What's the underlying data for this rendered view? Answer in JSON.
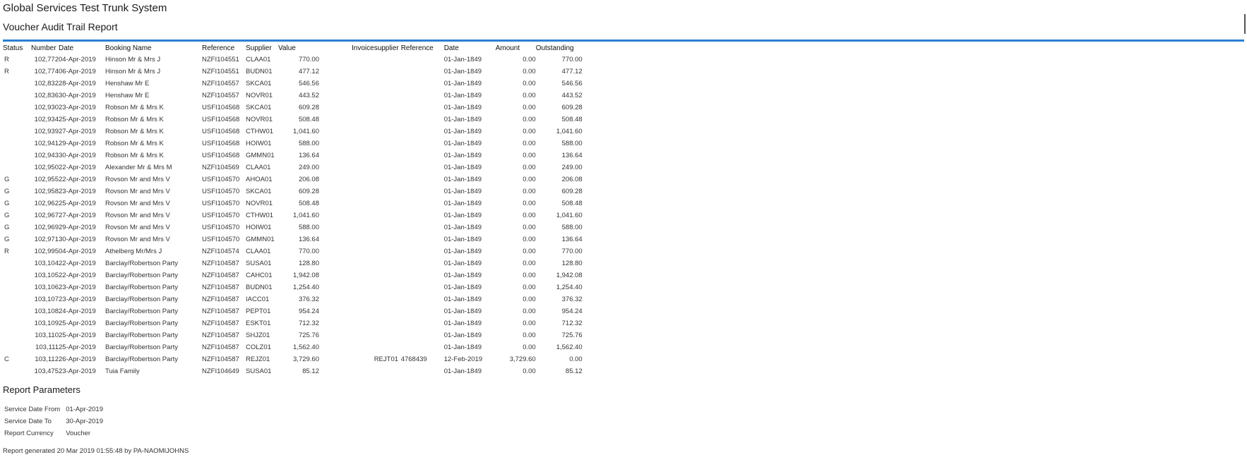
{
  "header": {
    "app_title": "Global Services Test Trunk System",
    "report_title": "Voucher Audit Trail Report",
    "accent_color": "#2a7fd4"
  },
  "table": {
    "columns": [
      "Status",
      "Number",
      "Date",
      "Booking Name",
      "Reference",
      "Supplier",
      "Value",
      "Invoice",
      "supplier",
      "Reference",
      "Date",
      "Amount",
      "Outstanding"
    ],
    "rows": [
      [
        "R",
        "102,772",
        "04-Apr-2019",
        "Hinson Mr & Mrs J",
        "NZFI104551",
        "CLAA01",
        "770.00",
        "",
        "",
        "",
        "01-Jan-1849",
        "0.00",
        "770.00"
      ],
      [
        "R",
        "102,774",
        "06-Apr-2019",
        "Hinson Mr & Mrs J",
        "NZFI104551",
        "BUDN01",
        "477.12",
        "",
        "",
        "",
        "01-Jan-1849",
        "0.00",
        "477.12"
      ],
      [
        "",
        "102,832",
        "28-Apr-2019",
        "Henshaw Mr E",
        "NZFI104557",
        "SKCA01",
        "546.56",
        "",
        "",
        "",
        "01-Jan-1849",
        "0.00",
        "546.56"
      ],
      [
        "",
        "102,836",
        "30-Apr-2019",
        "Henshaw Mr E",
        "NZFI104557",
        "NOVR01",
        "443.52",
        "",
        "",
        "",
        "01-Jan-1849",
        "0.00",
        "443.52"
      ],
      [
        "",
        "102,930",
        "23-Apr-2019",
        "Robson Mr & Mrs K",
        "USFI104568",
        "SKCA01",
        "609.28",
        "",
        "",
        "",
        "01-Jan-1849",
        "0.00",
        "609.28"
      ],
      [
        "",
        "102,934",
        "25-Apr-2019",
        "Robson Mr & Mrs K",
        "USFI104568",
        "NOVR01",
        "508.48",
        "",
        "",
        "",
        "01-Jan-1849",
        "0.00",
        "508.48"
      ],
      [
        "",
        "102,939",
        "27-Apr-2019",
        "Robson Mr & Mrs K",
        "USFI104568",
        "CTHW01",
        "1,041.60",
        "",
        "",
        "",
        "01-Jan-1849",
        "0.00",
        "1,041.60"
      ],
      [
        "",
        "102,941",
        "29-Apr-2019",
        "Robson Mr & Mrs K",
        "USFI104568",
        "HOIW01",
        "588.00",
        "",
        "",
        "",
        "01-Jan-1849",
        "0.00",
        "588.00"
      ],
      [
        "",
        "102,943",
        "30-Apr-2019",
        "Robson Mr & Mrs K",
        "USFI104568",
        "GMMN01",
        "136.64",
        "",
        "",
        "",
        "01-Jan-1849",
        "0.00",
        "136.64"
      ],
      [
        "",
        "102,950",
        "22-Apr-2019",
        "Alexander Mr & Mrs M",
        "NZFI104569",
        "CLAA01",
        "249.00",
        "",
        "",
        "",
        "01-Jan-1849",
        "0.00",
        "249.00"
      ],
      [
        "G",
        "102,955",
        "22-Apr-2019",
        "Rovson Mr and Mrs V",
        "USFI104570",
        "AHOA01",
        "206.08",
        "",
        "",
        "",
        "01-Jan-1849",
        "0.00",
        "206.08"
      ],
      [
        "G",
        "102,958",
        "23-Apr-2019",
        "Rovson Mr and Mrs V",
        "USFI104570",
        "SKCA01",
        "609.28",
        "",
        "",
        "",
        "01-Jan-1849",
        "0.00",
        "609.28"
      ],
      [
        "G",
        "102,962",
        "25-Apr-2019",
        "Rovson Mr and Mrs V",
        "USFI104570",
        "NOVR01",
        "508.48",
        "",
        "",
        "",
        "01-Jan-1849",
        "0.00",
        "508.48"
      ],
      [
        "G",
        "102,967",
        "27-Apr-2019",
        "Rovson Mr and Mrs V",
        "USFI104570",
        "CTHW01",
        "1,041.60",
        "",
        "",
        "",
        "01-Jan-1849",
        "0.00",
        "1,041.60"
      ],
      [
        "G",
        "102,969",
        "29-Apr-2019",
        "Rovson Mr and Mrs V",
        "USFI104570",
        "HOIW01",
        "588.00",
        "",
        "",
        "",
        "01-Jan-1849",
        "0.00",
        "588.00"
      ],
      [
        "G",
        "102,971",
        "30-Apr-2019",
        "Rovson Mr and Mrs V",
        "USFI104570",
        "GMMN01",
        "136.64",
        "",
        "",
        "",
        "01-Jan-1849",
        "0.00",
        "136.64"
      ],
      [
        "R",
        "102,995",
        "04-Apr-2019",
        "Athelberg Mr/Mrs J",
        "NZFI104574",
        "CLAA01",
        "770.00",
        "",
        "",
        "",
        "01-Jan-1849",
        "0.00",
        "770.00"
      ],
      [
        "",
        "103,104",
        "22-Apr-2019",
        "Barclay/Robertson Party",
        "NZFI104587",
        "SUSA01",
        "128.80",
        "",
        "",
        "",
        "01-Jan-1849",
        "0.00",
        "128.80"
      ],
      [
        "",
        "103,105",
        "22-Apr-2019",
        "Barclay/Robertson Party",
        "NZFI104587",
        "CAHC01",
        "1,942.08",
        "",
        "",
        "",
        "01-Jan-1849",
        "0.00",
        "1,942.08"
      ],
      [
        "",
        "103,106",
        "23-Apr-2019",
        "Barclay/Robertson Party",
        "NZFI104587",
        "BUDN01",
        "1,254.40",
        "",
        "",
        "",
        "01-Jan-1849",
        "0.00",
        "1,254.40"
      ],
      [
        "",
        "103,107",
        "23-Apr-2019",
        "Barclay/Robertson Party",
        "NZFI104587",
        "IACC01",
        "376.32",
        "",
        "",
        "",
        "01-Jan-1849",
        "0.00",
        "376.32"
      ],
      [
        "",
        "103,108",
        "24-Apr-2019",
        "Barclay/Robertson Party",
        "NZFI104587",
        "PEPT01",
        "954.24",
        "",
        "",
        "",
        "01-Jan-1849",
        "0.00",
        "954.24"
      ],
      [
        "",
        "103,109",
        "25-Apr-2019",
        "Barclay/Robertson Party",
        "NZFI104587",
        "ESKT01",
        "712.32",
        "",
        "",
        "",
        "01-Jan-1849",
        "0.00",
        "712.32"
      ],
      [
        "",
        "103,110",
        "25-Apr-2019",
        "Barclay/Robertson Party",
        "NZFI104587",
        "SHJZ01",
        "725.76",
        "",
        "",
        "",
        "01-Jan-1849",
        "0.00",
        "725.76"
      ],
      [
        "",
        "103,111",
        "25-Apr-2019",
        "Barclay/Robertson Party",
        "NZFI104587",
        "COLZ01",
        "1,562.40",
        "",
        "",
        "",
        "01-Jan-1849",
        "0.00",
        "1,562.40"
      ],
      [
        "C",
        "103,112",
        "26-Apr-2019",
        "Barclay/Robertson Party",
        "NZFI104587",
        "REJZ01",
        "3,729.60",
        "",
        "REJT01",
        "4768439",
        "12-Feb-2019",
        "3,729.60",
        "0.00"
      ],
      [
        "",
        "103,475",
        "23-Apr-2019",
        "Tuia Family",
        "NZFI104649",
        "SUSA01",
        "85.12",
        "",
        "",
        "",
        "01-Jan-1849",
        "0.00",
        "85.12"
      ]
    ]
  },
  "params": {
    "title": "Report Parameters",
    "rows": [
      [
        "Service Date From",
        "01-Apr-2019"
      ],
      [
        "Service Date To",
        "30-Apr-2019"
      ],
      [
        "Report Currency",
        "Voucher"
      ]
    ]
  },
  "footer": {
    "text": "Report generated 20 Mar 2019 01:55:48 by PA-NAOMIJOHNS"
  }
}
